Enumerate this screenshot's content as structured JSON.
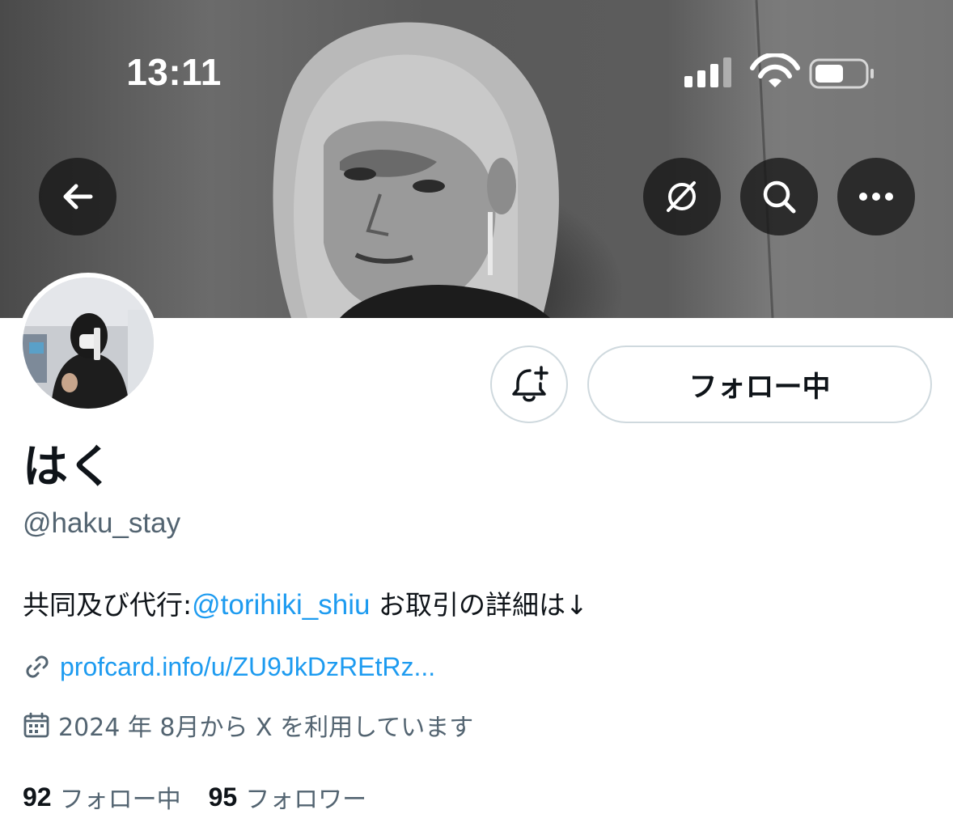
{
  "status_bar": {
    "time": "13:11",
    "icons": [
      "cellular-signal-icon",
      "wifi-icon",
      "battery-icon"
    ]
  },
  "header": {
    "back_icon": "arrow-left-icon",
    "actions": [
      "grok-icon",
      "search-icon",
      "more-icon"
    ]
  },
  "profile": {
    "display_name": "はく",
    "handle": "@haku_stay",
    "bio_prefix": "共同及び代行:",
    "bio_mention": "@torihiki_shiu",
    "bio_suffix": " お取引の詳細は↓",
    "link_icon": "link-icon",
    "link_text": "profcard.info/u/ZU9JkDzREtRz...",
    "joined_icon": "calendar-icon",
    "joined_text": "2024 年 8月から X を利用しています"
  },
  "actions": {
    "notify_icon": "bell-plus-icon",
    "follow_label": "フォロー中"
  },
  "stats": {
    "following_count": "92",
    "following_label": "フォロー中",
    "followers_count": "95",
    "followers_label": "フォロワー"
  },
  "colors": {
    "accent": "#1d9bf0",
    "text_primary": "#0f1419",
    "text_secondary": "#536471",
    "border": "#cfd9de"
  }
}
